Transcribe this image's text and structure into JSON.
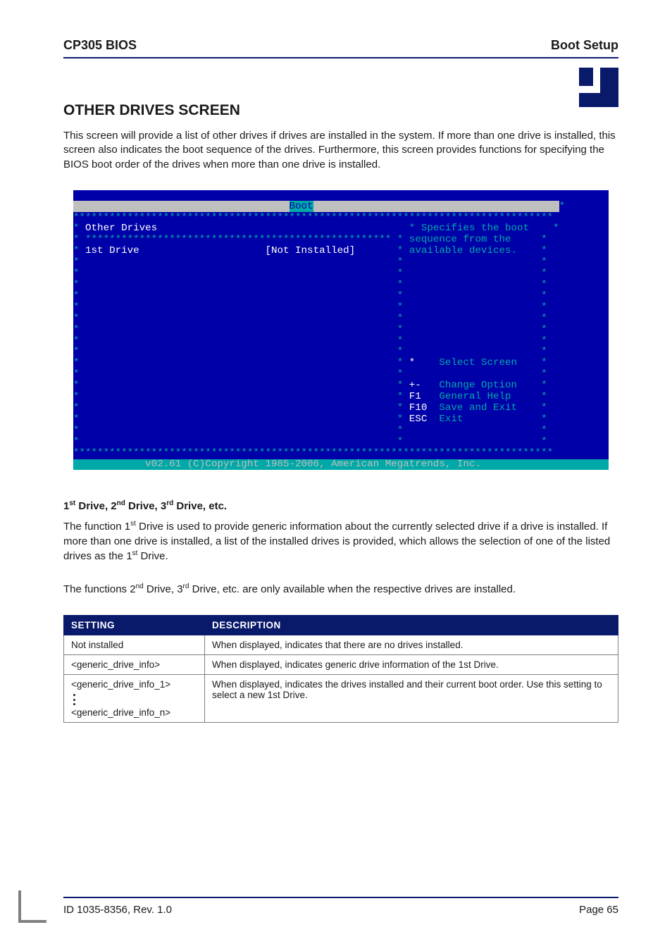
{
  "header": {
    "left": "CP305 BIOS",
    "right": "Boot Setup"
  },
  "section": {
    "title": "OTHER DRIVES SCREEN",
    "intro": "This screen will provide a list of other drives if drives are installed in the system. If more than one drive is installed, this screen also indicates the boot sequence of the drives. Furthermore, this screen provides functions for specifying the BIOS boot order of the drives when more than one drive is installed."
  },
  "bios": {
    "menu": "Boot",
    "panel_title": "Other Drives",
    "row_label": "1st Drive",
    "row_value": "[Not Installed]",
    "help_line1": "Specifies the boot",
    "help_line2": "sequence from the",
    "help_line3": "available devices.",
    "legend": {
      "select": {
        "key": "*",
        "label": "Select Screen"
      },
      "change": {
        "key": "+-",
        "label": "Change Option"
      },
      "help": {
        "key": "F1",
        "label": "General Help"
      },
      "save": {
        "key": "F10",
        "label": "Save and Exit"
      },
      "exit": {
        "key": "ESC",
        "label": "Exit"
      }
    },
    "copyright": "v02.61 (C)Copyright 1985-2006, American Megatrends, Inc."
  },
  "drives": {
    "heading_prefix1": "1",
    "heading_suffix1": "st",
    "heading_mid1": " Drive, ",
    "heading_prefix2": "2",
    "heading_suffix2": "nd",
    "heading_mid2": " Drive, ",
    "heading_prefix3": "3",
    "heading_suffix3": "rd",
    "heading_tail": " Drive, etc.",
    "p1a": "The function 1",
    "p1a_sup": "st",
    "p1b": " Drive is used to provide generic information about the currently selected drive if a drive is installed. If more than one drive is installed, a list of the installed drives is provided, which allows the selection of one of the listed drives as the 1",
    "p1b_sup": "st",
    "p1c": " Drive.",
    "p2a": "The functions 2",
    "p2a_sup": "nd",
    "p2b": " Drive, 3",
    "p2b_sup": "rd",
    "p2c": " Drive, etc. are only available when the respective drives are installed."
  },
  "table": {
    "col1": "SETTING",
    "col2": "DESCRIPTION",
    "rows": [
      {
        "setting": "Not installed",
        "desc": "When displayed, indicates that there are no drives installed."
      },
      {
        "setting": "<generic_drive_info>",
        "desc": "When displayed, indicates generic drive information of the 1st Drive."
      },
      {
        "setting_a": "<generic_drive_info_1>",
        "setting_b": "<generic_drive_info_n>",
        "desc": "When displayed, indicates the drives installed and their current boot order. Use this setting to select a new 1st Drive."
      }
    ]
  },
  "footer": {
    "left": "ID 1035-8356, Rev. 1.0",
    "right": "Page 65"
  }
}
